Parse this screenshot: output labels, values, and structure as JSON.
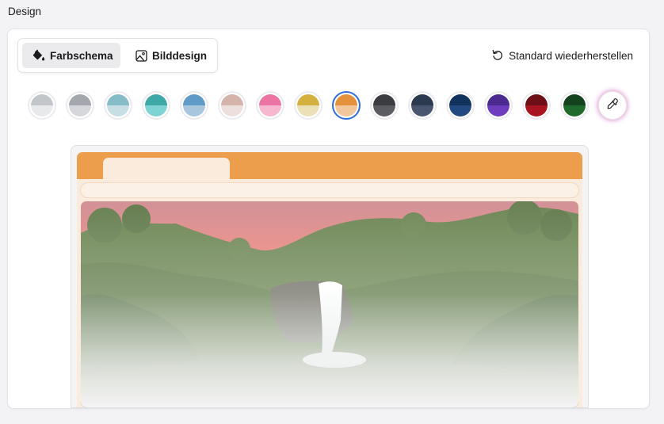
{
  "section_title": "Design",
  "tabs": [
    {
      "label": "Farbschema",
      "icon": "paint-bucket-icon",
      "active": true
    },
    {
      "label": "Bilddesign",
      "icon": "image-icon",
      "active": false
    }
  ],
  "reset": {
    "label": "Standard wiederherstellen",
    "icon": "undo-icon"
  },
  "swatches": [
    {
      "name": "gray-light",
      "top": "#c2c6ca",
      "bottom": "#e8e9eb"
    },
    {
      "name": "gray",
      "top": "#a4a7ad",
      "bottom": "#d6d7db"
    },
    {
      "name": "light-teal",
      "top": "#86bcc8",
      "bottom": "#c6dfe5"
    },
    {
      "name": "teal",
      "top": "#3ea8a6",
      "bottom": "#7fd3d3"
    },
    {
      "name": "steel-blue",
      "top": "#5f9bc6",
      "bottom": "#a8c7de"
    },
    {
      "name": "dusty-rose",
      "top": "#d4b3ab",
      "bottom": "#ede0dc"
    },
    {
      "name": "pink",
      "top": "#ec74a4",
      "bottom": "#f7b8cf"
    },
    {
      "name": "gold",
      "top": "#d4b03e",
      "bottom": "#ece1b6"
    },
    {
      "name": "orange",
      "top": "#e3913a",
      "bottom": "#f3c79c",
      "selected": true
    },
    {
      "name": "charcoal",
      "top": "#3a3c40",
      "bottom": "#5b5d63"
    },
    {
      "name": "slate",
      "top": "#2c3a4f",
      "bottom": "#4a5670"
    },
    {
      "name": "navy",
      "top": "#12325e",
      "bottom": "#224a80"
    },
    {
      "name": "purple",
      "top": "#4a2a8e",
      "bottom": "#6d3dbe"
    },
    {
      "name": "crimson",
      "top": "#6e0f17",
      "bottom": "#a8141f"
    },
    {
      "name": "forest-green",
      "top": "#15421e",
      "bottom": "#1f6a2c"
    }
  ],
  "picker": {
    "icon": "eyedropper-icon"
  },
  "colors": {
    "accent_selected": "#2f6ed8",
    "preview_header": "#ec9e4d",
    "preview_surface": "#faebdd"
  }
}
